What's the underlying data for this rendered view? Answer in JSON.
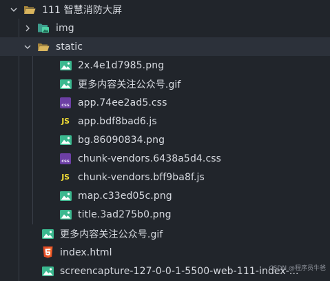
{
  "explorer": {
    "root_folder": {
      "label": "111 智慧消防大屏",
      "expanded": true
    },
    "img_folder": {
      "label": "img",
      "expanded": false
    },
    "static_folder": {
      "label": "static",
      "expanded": true
    },
    "static_files": [
      {
        "name": "2x.4e1d7985.png",
        "icon": "image-icon"
      },
      {
        "name": "更多内容关注公众号.gif",
        "icon": "image-icon"
      },
      {
        "name": "app.74ee2ad5.css",
        "icon": "css-icon"
      },
      {
        "name": "app.bdf8bad6.js",
        "icon": "js-icon"
      },
      {
        "name": "bg.86090834.png",
        "icon": "image-icon"
      },
      {
        "name": "chunk-vendors.6438a5d4.css",
        "icon": "css-icon"
      },
      {
        "name": "chunk-vendors.bff9ba8f.js",
        "icon": "js-icon"
      },
      {
        "name": "map.c33ed05c.png",
        "icon": "image-icon"
      },
      {
        "name": "title.3ad275b0.png",
        "icon": "image-icon"
      }
    ],
    "root_files": [
      {
        "name": "更多内容关注公众号.gif",
        "icon": "image-icon"
      },
      {
        "name": "index.html",
        "icon": "html5-icon"
      },
      {
        "name": "screencapture-127-0-0-1-5500-web-111-index-...",
        "icon": "image-icon"
      }
    ],
    "icon_text": {
      "css": "css",
      "js": "JS"
    },
    "colors": {
      "background": "#21252b",
      "selected_row": "#2c313a",
      "folder": "#c8a14b",
      "image": "#3bb88f",
      "css": "#6c3fa4",
      "js": "#f1dd35",
      "html": "#e44d26"
    }
  },
  "watermark": "CSDN @程序员牛爸"
}
